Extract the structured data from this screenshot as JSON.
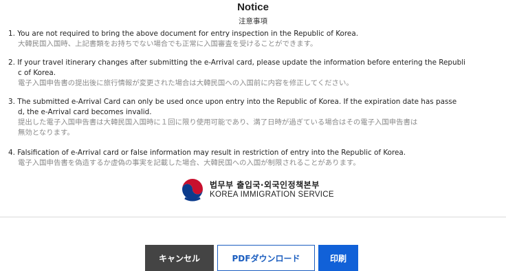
{
  "dialog": {
    "title": "Notice",
    "subtitle": "注意事項"
  },
  "notices": [
    {
      "en_line1": "1. You are not required to bring the above document for entry inspection in the Republic of Korea.",
      "en_line2": "",
      "ja_line1": "大韓民国入国時、上記書類をお持ちでない場合でも正常に入国審査を受けることができます。",
      "ja_line2": ""
    },
    {
      "en_line1": "2. If your travel itinerary changes after submitting the e-Arrival card, please update the information before entering the Republi",
      "en_line2": "c of Korea.",
      "ja_line1": "電子入国申告書の提出後に旅行情報が変更された場合は大韓民国への入国前に内容を修正してください。",
      "ja_line2": ""
    },
    {
      "en_line1": "3. The submitted e-Arrival Card can only be used once upon entry into the Republic of Korea. If the expiration date has passe",
      "en_line2": "d, the e-Arrival card becomes invalid.",
      "ja_line1": "提出した電子入国申告書は大韓民国入国時に１回に限り使用可能であり、満了日時が過ぎている場合はその電子入国申告書は",
      "ja_line2": "無効となります。"
    },
    {
      "en_line1": "4. Falsification of e-Arrival card or false information may result in restriction of entry into the Republic of Korea.",
      "en_line2": "",
      "ja_line1": "電子入国申告書を偽造するか虚偽の事実を記載した場合、大韓民国への入国が制限されることがあります。",
      "ja_line2": ""
    }
  ],
  "logo": {
    "korean": "법무부 출입국·외국인정책본부",
    "english": "KOREA IMMIGRATION SERVICE",
    "emblem_icon": "taegeuk-emblem-icon"
  },
  "buttons": {
    "cancel_label": "キャンセル",
    "pdf_label": "PDFダウンロード",
    "print_label": "印刷"
  },
  "colors": {
    "cancel_bg": "#444444",
    "pdf_border": "#1a5dbf",
    "print_bg": "#1161d8",
    "japanese_text": "#8a8a8a"
  }
}
